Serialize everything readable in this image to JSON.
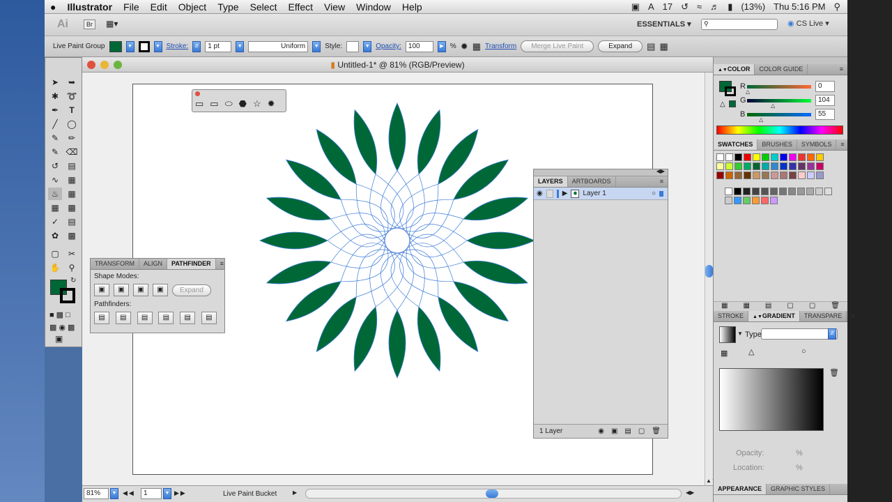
{
  "menubar": {
    "apple": "",
    "app": "Illustrator",
    "items": [
      "File",
      "Edit",
      "Object",
      "Type",
      "Select",
      "Effect",
      "View",
      "Window",
      "Help"
    ],
    "status_items": [
      "17",
      "(13%)",
      "Thu 5:16 PM"
    ]
  },
  "appbar": {
    "ai_logo": "Ai",
    "br": "Br",
    "essentials": "ESSENTIALS ▾",
    "cs_live": "CS Live ▾"
  },
  "control": {
    "group_label": "Live Paint Group",
    "stroke_label": "Stroke:",
    "stroke_value": "1 pt",
    "uniform": "Uniform",
    "style_label": "Style:",
    "opacity_label": "Opacity:",
    "opacity_value": "100",
    "percent": "%",
    "transform": "Transform",
    "merge": "Merge Live Paint",
    "expand": "Expand"
  },
  "document": {
    "title": "Untitled-1* @ 81% (RGB/Preview)"
  },
  "status": {
    "zoom": "81%",
    "page": "1",
    "tool": "Live Paint Bucket"
  },
  "pathfinder": {
    "tabs": [
      "TRANSFORM",
      "ALIGN",
      "PATHFINDER"
    ],
    "shape_modes": "Shape Modes:",
    "expand": "Expand",
    "pathfinders": "Pathfinders:"
  },
  "layers": {
    "tabs": [
      "LAYERS",
      "ARTBOARDS"
    ],
    "layer_name": "Layer 1",
    "count": "1 Layer"
  },
  "color": {
    "tabs": [
      "COLOR",
      "COLOR GUIDE"
    ],
    "r_label": "R",
    "g_label": "G",
    "b_label": "B",
    "r": "0",
    "g": "104",
    "b": "55"
  },
  "swatches": {
    "tabs": [
      "SWATCHES",
      "BRUSHES",
      "SYMBOLS"
    ]
  },
  "gradient": {
    "tabs": [
      "STROKE",
      "GRADIENT",
      "TRANSPARE"
    ],
    "type_label": "Type",
    "opacity_label": "Opacity:",
    "location_label": "Location:",
    "percent": "%"
  },
  "appearance": {
    "tabs": [
      "APPEARANCE",
      "GRAPHIC STYLES"
    ]
  },
  "colors": {
    "fill": "#006837",
    "accent": "#3b7bd8"
  }
}
